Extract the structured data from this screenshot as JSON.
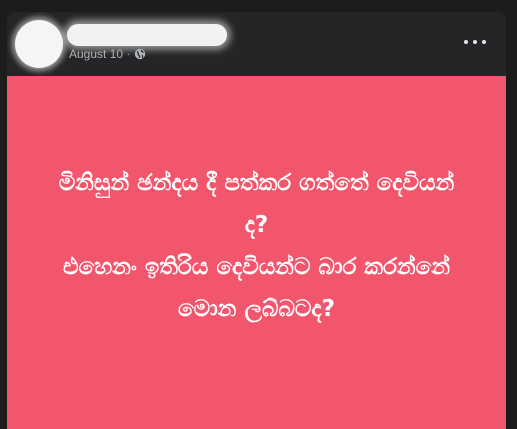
{
  "post": {
    "date": "August 10",
    "separator": "·",
    "privacy_icon": "globe-icon",
    "more_icon": "more-options-icon",
    "background_color": "#f2566d",
    "lines": [
      "මිනිසුන් ඡන්දය දී පත්කර ගත්තේ දෙවියන්",
      "ද?",
      "එහෙනං ඉතිරිය දෙවියන්ට බාර කරන්නේ",
      "මොන ලබ්බටද?"
    ]
  }
}
